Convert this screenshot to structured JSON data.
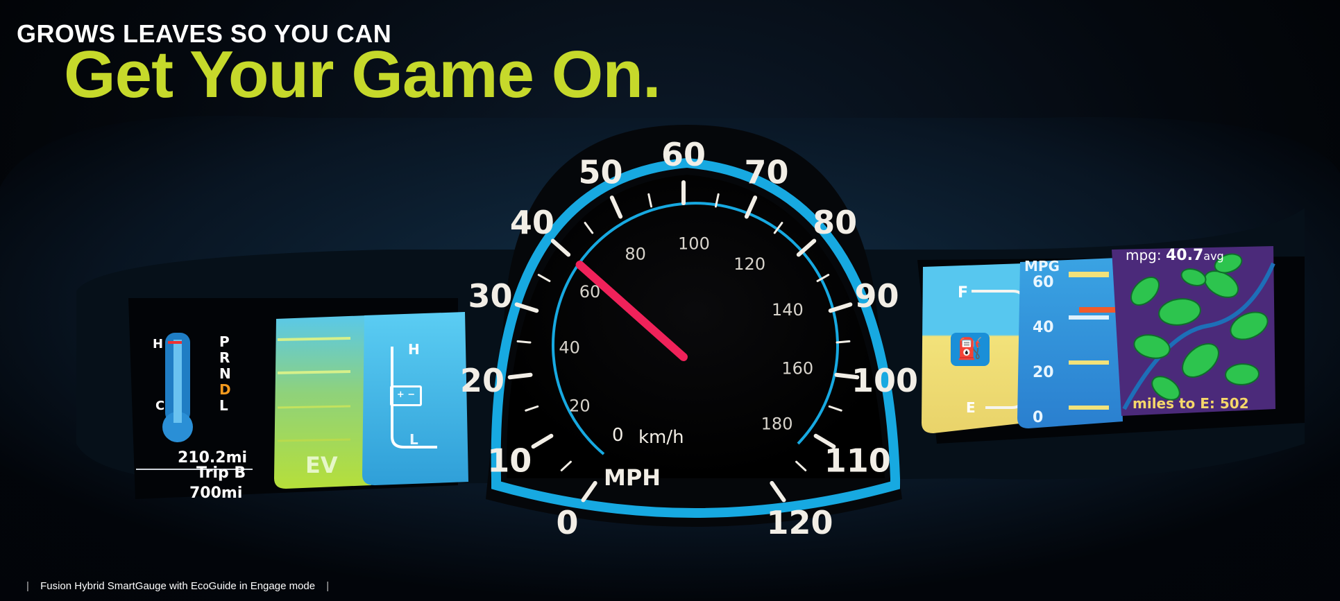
{
  "header": {
    "kicker": "GROWS LEAVES SO YOU CAN",
    "headline": "Get Your Game On."
  },
  "caption": {
    "text": "Fusion Hybrid SmartGauge with EcoGuide in Engage mode",
    "separator": "|"
  },
  "speedometer": {
    "mph_ticks": [
      "0",
      "10",
      "20",
      "30",
      "40",
      "50",
      "60",
      "70",
      "80",
      "90",
      "100",
      "110",
      "120"
    ],
    "kmh_ticks": [
      "20",
      "40",
      "60",
      "80",
      "100",
      "120",
      "140",
      "160",
      "180"
    ],
    "kmh_zero": "0",
    "kmh_unit": "km/h",
    "mph_unit": "MPH",
    "needle_value_mph": 40,
    "needle_color": "#f0225a",
    "ring_color": "#17a9e1"
  },
  "left_display": {
    "temp_high": "H",
    "temp_low": "C",
    "gears": [
      "P",
      "R",
      "N",
      "D",
      "L"
    ],
    "active_gear": "D",
    "trip_distance": "210.2mi",
    "trip_label": "Trip B",
    "range": "700mi",
    "ev_label": "EV",
    "battery_high": "H",
    "battery_low": "L",
    "battery_icon": "battery-icon"
  },
  "right_display": {
    "fuel_full": "F",
    "fuel_empty": "E",
    "fuel_icon": "fuel-pump-icon",
    "mpg_label": "MPG",
    "mpg_ticks": [
      "60",
      "40",
      "20",
      "0"
    ],
    "mpg_avg_label": "mpg:",
    "mpg_avg_value": "40.7",
    "mpg_avg_suffix": "avg",
    "miles_to_empty_label": "miles to E:",
    "miles_to_empty_value": "502",
    "leaf_color": "#2dc44e",
    "accent_yellow": "#f2e27a"
  }
}
